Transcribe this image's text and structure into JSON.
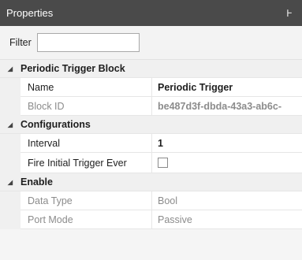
{
  "panel": {
    "title": "Properties",
    "pin_glyph": "Ͱ",
    "pin_icon": "pin-icon"
  },
  "filter": {
    "label": "Filter",
    "value": "",
    "placeholder": ""
  },
  "categories": [
    {
      "label": "Periodic Trigger Block",
      "expanded": true,
      "properties": [
        {
          "name": "Name",
          "value": "Periodic Trigger",
          "readonly": false
        },
        {
          "name": "Block ID",
          "value": "be487d3f-dbda-43a3-ab6c-",
          "readonly": true
        }
      ]
    },
    {
      "label": "Configurations",
      "expanded": true,
      "properties": [
        {
          "name": "Interval",
          "value": "1",
          "readonly": false
        },
        {
          "name": "Fire Initial Trigger Ever",
          "value": false,
          "readonly": false,
          "editor": "checkbox"
        }
      ]
    },
    {
      "label": "Enable",
      "expanded": true,
      "properties": [
        {
          "name": "Data Type",
          "value": "Bool",
          "readonly": true
        },
        {
          "name": "Port Mode",
          "value": "Passive",
          "readonly": true
        }
      ]
    }
  ],
  "expander_glyph": "◢",
  "colors": {
    "titlebar_bg": "#4a4a4a",
    "readonly_text": "#8c8c8c",
    "category_bg": "#f0f0f0"
  }
}
